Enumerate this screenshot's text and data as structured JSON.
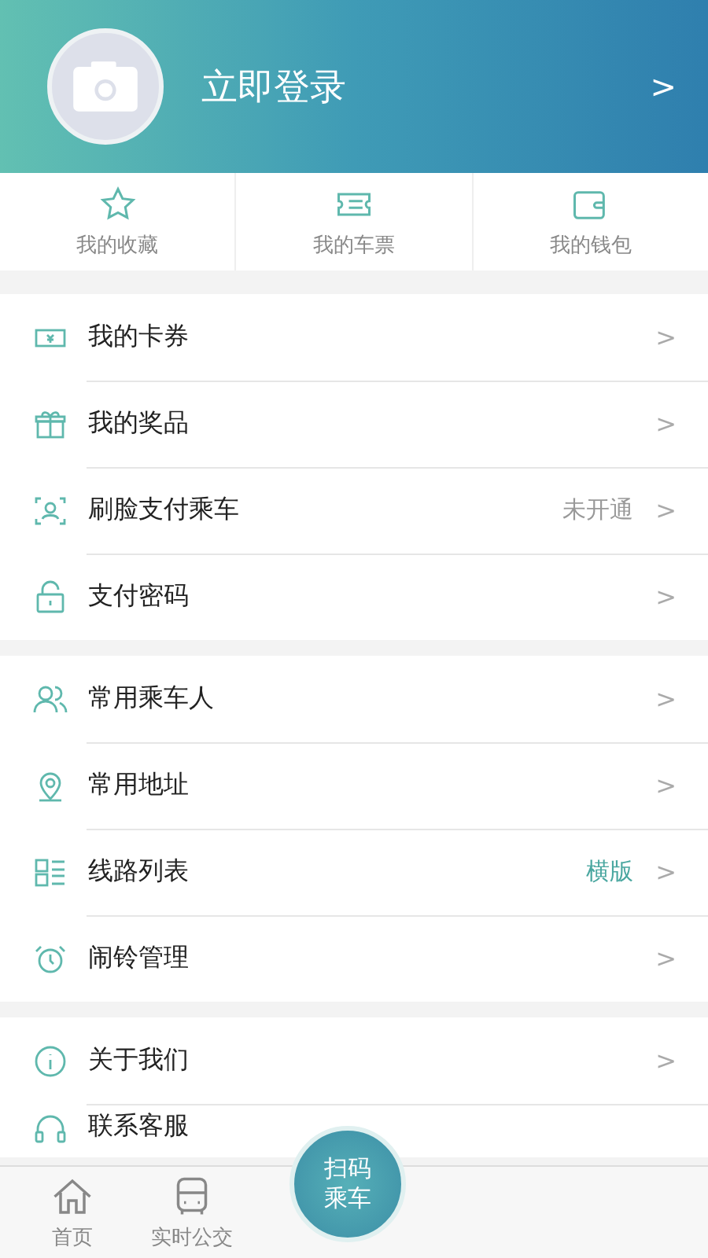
{
  "header": {
    "login": "立即登录",
    "chevron": ">"
  },
  "shortcuts": [
    {
      "kind": "star",
      "label": "我的收藏"
    },
    {
      "kind": "ticket",
      "label": "我的车票"
    },
    {
      "kind": "wallet",
      "label": "我的钱包"
    }
  ],
  "groups": [
    [
      {
        "kind": "coupon",
        "label": "我的卡券"
      },
      {
        "kind": "gift",
        "label": "我的奖品"
      },
      {
        "kind": "face",
        "label": "刷脸支付乘车",
        "value": "未开通",
        "accent": false
      },
      {
        "kind": "lock",
        "label": "支付密码"
      }
    ],
    [
      {
        "kind": "people",
        "label": "常用乘车人"
      },
      {
        "kind": "pin",
        "label": "常用地址"
      },
      {
        "kind": "list",
        "label": "线路列表",
        "value": "横版",
        "accent": true
      },
      {
        "kind": "alarm",
        "label": "闹铃管理"
      }
    ],
    [
      {
        "kind": "info",
        "label": "关于我们"
      },
      {
        "kind": "headset",
        "label": "联系客服"
      }
    ]
  ],
  "chevron": ">",
  "tabbar": {
    "tabs": [
      {
        "kind": "home",
        "label": "首页",
        "selected": false
      },
      {
        "kind": "bus",
        "label": "实时公交",
        "selected": false
      }
    ],
    "scan": [
      "扫码",
      "乘车"
    ]
  }
}
